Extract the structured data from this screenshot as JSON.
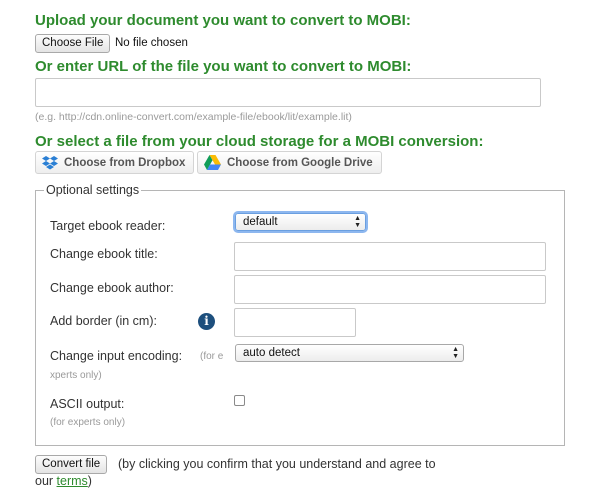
{
  "upload": {
    "heading": "Upload your document you want to convert to MOBI:",
    "choose_file_label": "Choose File",
    "file_status": "No file chosen"
  },
  "url": {
    "heading": "Or enter URL of the file you want to convert to MOBI:",
    "value": "",
    "example": "(e.g. http://cdn.online-convert.com/example-file/ebook/lit/example.lit)"
  },
  "cloud": {
    "heading": "Or select a file from your cloud storage for a MOBI conversion:",
    "dropbox_label": "Choose from Dropbox",
    "gdrive_label": "Choose from Google Drive"
  },
  "optional": {
    "legend": "Optional settings",
    "target_reader": {
      "label": "Target ebook reader:",
      "value": "default"
    },
    "title": {
      "label": "Change ebook title:",
      "value": ""
    },
    "author": {
      "label": "Change ebook author:",
      "value": ""
    },
    "border": {
      "label": "Add border (in cm):",
      "value": ""
    },
    "encoding": {
      "label": "Change input encoding:",
      "note_a": "(for e",
      "note_b": "xperts only)",
      "value": "auto detect"
    },
    "ascii": {
      "label": "ASCII output:",
      "note": "(for experts only)",
      "checked": false
    }
  },
  "footer": {
    "convert_label": "Convert file",
    "text_line1": "(by clicking you confirm that you understand and agree to",
    "text_line2_prefix": "our ",
    "terms_link": "terms",
    "text_line2_suffix": ")"
  },
  "colors": {
    "heading_green": "#2e8b2e",
    "info_icon_blue": "#1d4f7d",
    "focus_ring": "#8db7ef"
  }
}
